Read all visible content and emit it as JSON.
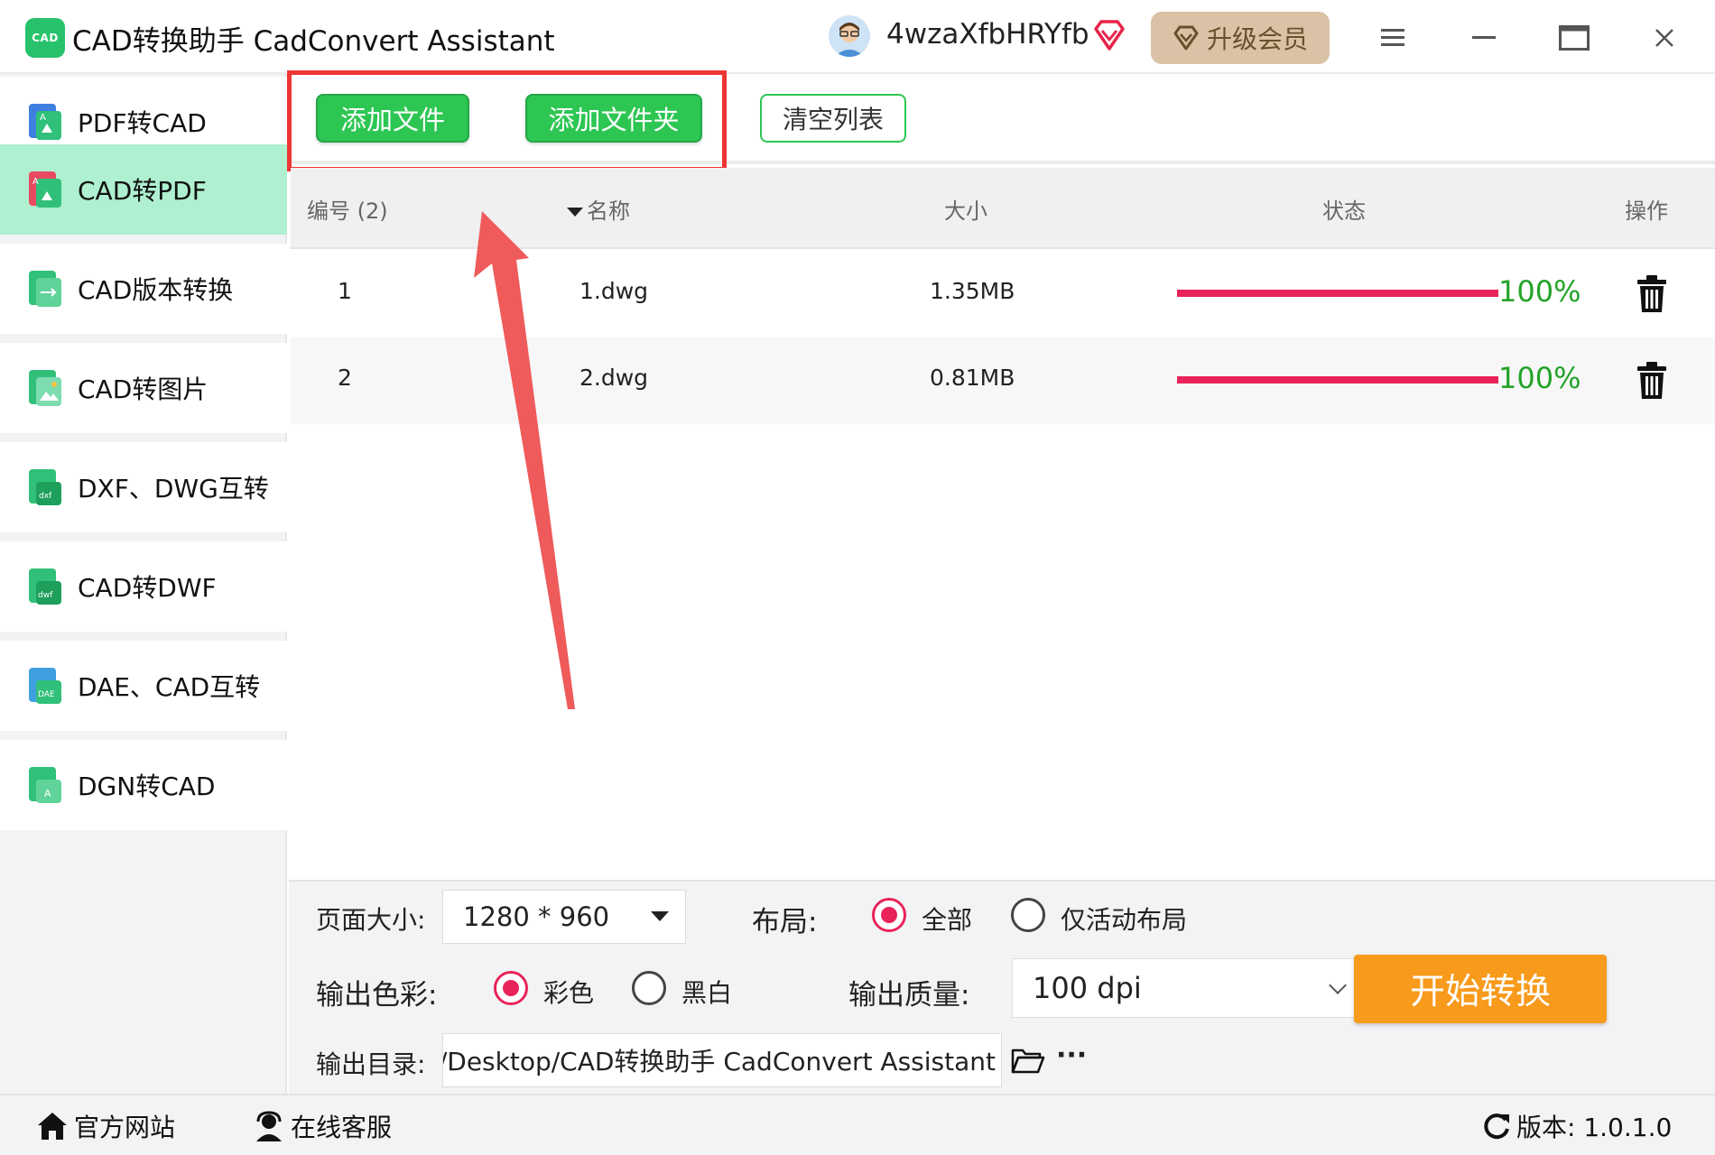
{
  "app": {
    "logo_text": "CAD",
    "title": "CAD转换助手 CadConvert Assistant",
    "username": "4wzaXfbHRYfb",
    "upgrade_label": "升级会员"
  },
  "sidebar": {
    "items": [
      {
        "label": "PDF转CAD",
        "active": false
      },
      {
        "label": "CAD转PDF",
        "active": true
      },
      {
        "label": "CAD版本转换",
        "active": false
      },
      {
        "label": "CAD转图片",
        "active": false
      },
      {
        "label": "DXF、DWG互转",
        "active": false
      },
      {
        "label": "CAD转DWF",
        "active": false
      },
      {
        "label": "DAE、CAD互转",
        "active": false
      },
      {
        "label": "DGN转CAD",
        "active": false
      }
    ]
  },
  "toolbar": {
    "add_file_label": "添加文件",
    "add_folder_label": "添加文件夹",
    "clear_list_label": "清空列表"
  },
  "table": {
    "headers": {
      "number": "编号 (2)",
      "name": "名称",
      "size": "大小",
      "status": "状态",
      "action": "操作"
    },
    "rows": [
      {
        "number": "1",
        "name": "1.dwg",
        "size": "1.35MB",
        "progress_pct": 100,
        "progress_text": "100%"
      },
      {
        "number": "2",
        "name": "2.dwg",
        "size": "0.81MB",
        "progress_pct": 100,
        "progress_text": "100%"
      }
    ]
  },
  "settings": {
    "page_size_label": "页面大小:",
    "page_size_value": "1280 * 960",
    "layout_label": "布局:",
    "layout_options": [
      {
        "label": "全部",
        "checked": true
      },
      {
        "label": "仅活动布局",
        "checked": false
      }
    ],
    "color_label": "输出色彩:",
    "color_options": [
      {
        "label": "彩色",
        "checked": true
      },
      {
        "label": "黑白",
        "checked": false
      }
    ],
    "quality_label": "输出质量:",
    "quality_value": "100 dpi",
    "output_dir_label": "输出目录:",
    "output_dir_value": "/Desktop/CAD转换助手 CadConvert Assistant",
    "more_label": "···",
    "start_label": "开始转换"
  },
  "footer": {
    "website_label": "官方网站",
    "support_label": "在线客服",
    "version_text": "版本: 1.0.1.0"
  },
  "colors": {
    "accent_green": "#2dc653",
    "active_nav": "#aef0cf",
    "progress": "#e8235a",
    "percent_text": "#23a329",
    "start_button": "#f89a1c",
    "annotation_red": "#ef3535"
  }
}
